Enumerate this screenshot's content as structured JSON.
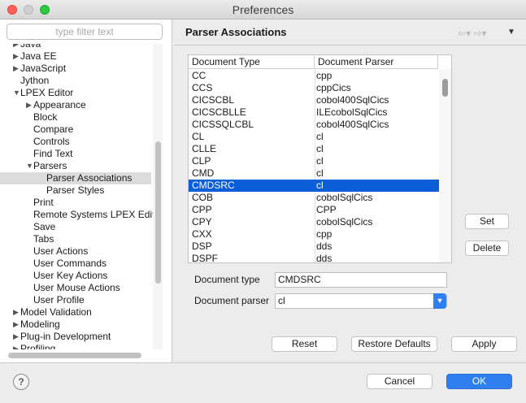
{
  "window": {
    "title": "Preferences"
  },
  "filter": {
    "placeholder": "type filter text"
  },
  "tree": [
    {
      "label": "Java",
      "twisty": "▶",
      "depth": 0
    },
    {
      "label": "Java EE",
      "twisty": "▶",
      "depth": 0
    },
    {
      "label": "JavaScript",
      "twisty": "▶",
      "depth": 0
    },
    {
      "label": "Jython",
      "twisty": "",
      "depth": 0
    },
    {
      "label": "LPEX Editor",
      "twisty": "▼",
      "depth": 0
    },
    {
      "label": "Appearance",
      "twisty": "▶",
      "depth": 1
    },
    {
      "label": "Block",
      "twisty": "",
      "depth": 1
    },
    {
      "label": "Compare",
      "twisty": "",
      "depth": 1
    },
    {
      "label": "Controls",
      "twisty": "",
      "depth": 1
    },
    {
      "label": "Find Text",
      "twisty": "",
      "depth": 1
    },
    {
      "label": "Parsers",
      "twisty": "▼",
      "depth": 1
    },
    {
      "label": "Parser Associations",
      "twisty": "",
      "depth": 2,
      "selected": true
    },
    {
      "label": "Parser Styles",
      "twisty": "",
      "depth": 2
    },
    {
      "label": "Print",
      "twisty": "",
      "depth": 1
    },
    {
      "label": "Remote Systems LPEX Edito",
      "twisty": "",
      "depth": 1
    },
    {
      "label": "Save",
      "twisty": "",
      "depth": 1
    },
    {
      "label": "Tabs",
      "twisty": "",
      "depth": 1
    },
    {
      "label": "User Actions",
      "twisty": "",
      "depth": 1
    },
    {
      "label": "User Commands",
      "twisty": "",
      "depth": 1
    },
    {
      "label": "User Key Actions",
      "twisty": "",
      "depth": 1
    },
    {
      "label": "User Mouse Actions",
      "twisty": "",
      "depth": 1
    },
    {
      "label": "User Profile",
      "twisty": "",
      "depth": 1
    },
    {
      "label": "Model Validation",
      "twisty": "▶",
      "depth": 0
    },
    {
      "label": "Modeling",
      "twisty": "▶",
      "depth": 0
    },
    {
      "label": "Plug-in Development",
      "twisty": "▶",
      "depth": 0
    },
    {
      "label": "Profiling",
      "twisty": "▶",
      "depth": 0
    }
  ],
  "page": {
    "title": "Parser Associations"
  },
  "table": {
    "headers": [
      "Document Type",
      "Document Parser"
    ],
    "rows": [
      [
        "CC",
        "cpp"
      ],
      [
        "CCS",
        "cppCics"
      ],
      [
        "CICSCBL",
        "cobol400SqlCics"
      ],
      [
        "CICSCBLLE",
        "ILEcobolSqlCics"
      ],
      [
        "CICSSQLCBL",
        "cobol400SqlCics"
      ],
      [
        "CL",
        "cl"
      ],
      [
        "CLLE",
        "cl"
      ],
      [
        "CLP",
        "cl"
      ],
      [
        "CMD",
        "cl"
      ],
      [
        "CMDSRC",
        "cl"
      ],
      [
        "COB",
        "cobolSqlCics"
      ],
      [
        "CPP",
        "CPP"
      ],
      [
        "CPY",
        "cobolSqlCics"
      ],
      [
        "CXX",
        "cpp"
      ],
      [
        "DSP",
        "dds"
      ],
      [
        "DSPF",
        "dds"
      ]
    ],
    "selected_row": 9
  },
  "buttons": {
    "set": "Set",
    "delete": "Delete",
    "reset": "Reset",
    "restore_defaults": "Restore Defaults",
    "apply": "Apply",
    "cancel": "Cancel",
    "ok": "OK",
    "help": "?"
  },
  "form": {
    "doc_type_label": "Document type",
    "doc_type_value": "CMDSRC",
    "doc_parser_label": "Document parser",
    "doc_parser_value": "cl"
  },
  "nav": {
    "back": "⇦",
    "forward": "⇨",
    "menu": "▼",
    "dropdown": "▾"
  }
}
